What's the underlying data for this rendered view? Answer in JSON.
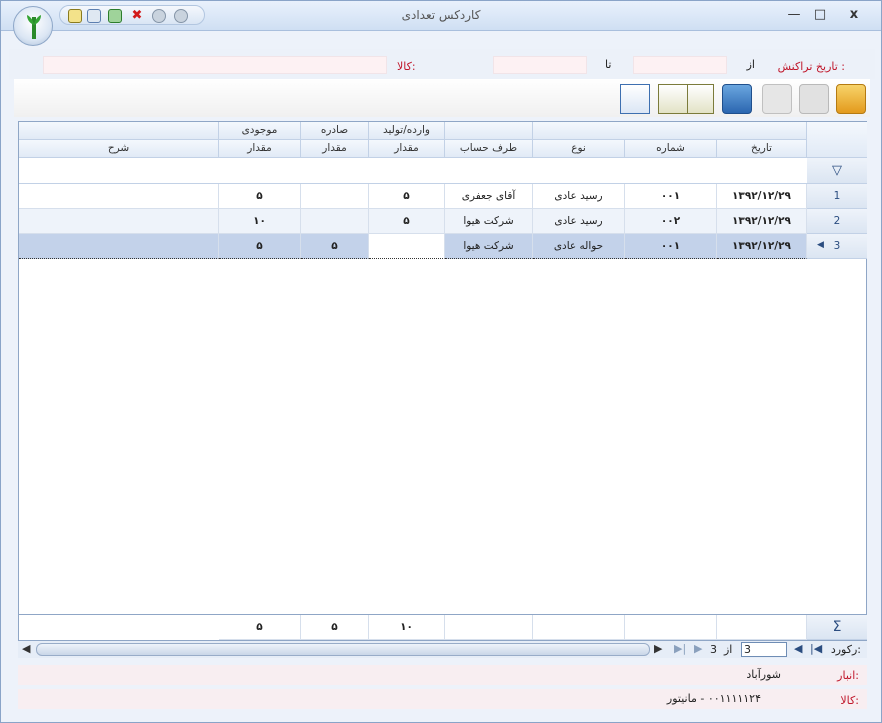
{
  "window": {
    "title": "کاردکس تعدادی",
    "min_glyph": "—",
    "max_glyph": "□",
    "close_glyph": "x"
  },
  "filters": {
    "date_label": "تاریخ تراکنش :",
    "from_label": "از",
    "to_label": "تا",
    "from_value": "",
    "to_value": "",
    "item_label": "کالا:",
    "item_value": ""
  },
  "grid": {
    "group_headers": {
      "stock": "موجودی",
      "issued": "صادره",
      "received": "وارده/تولید"
    },
    "columns": {
      "date": "تاریخ",
      "number": "شماره",
      "type": "نوع",
      "party": "طرف حساب",
      "in_qty": "مقدار",
      "out_qty": "مقدار",
      "bal_qty": "مقدار",
      "desc": "شرح"
    },
    "rows": [
      {
        "idx": "1",
        "date": "۱۳۹۲/۱۲/۲۹",
        "number": "۰۰۱",
        "type": "رسید عادی",
        "party": "آقای جعفری",
        "in_qty": "۵",
        "out_qty": "",
        "bal_qty": "۵",
        "desc": ""
      },
      {
        "idx": "2",
        "date": "۱۳۹۲/۱۲/۲۹",
        "number": "۰۰۲",
        "type": "رسید عادی",
        "party": "شرکت هیوا",
        "in_qty": "۵",
        "out_qty": "",
        "bal_qty": "۱۰",
        "desc": ""
      },
      {
        "idx": "3",
        "date": "۱۳۹۲/۱۲/۲۹",
        "number": "۰۰۱",
        "type": "حواله عادی",
        "party": "شرکت هیوا",
        "in_qty": "",
        "out_qty": "۵",
        "bal_qty": "۵",
        "desc": ""
      }
    ],
    "totals": {
      "in_qty": "۱۰",
      "out_qty": "۵",
      "bal_qty": "۵"
    },
    "sigma": "Σ"
  },
  "nav": {
    "record_label": "رکورد:",
    "current": "3",
    "of_label": "از",
    "total": "3"
  },
  "footer": {
    "warehouse_label": "انبار:",
    "warehouse_value": "شورآباد",
    "item_label": "کالا:",
    "item_value": "۰۰۱۱۱۱۱۲۴ - مانیتور"
  },
  "colors": {
    "accent": "#c0162a",
    "selected_row": "#c3d2ea",
    "grid_border": "#8fa6c6"
  }
}
